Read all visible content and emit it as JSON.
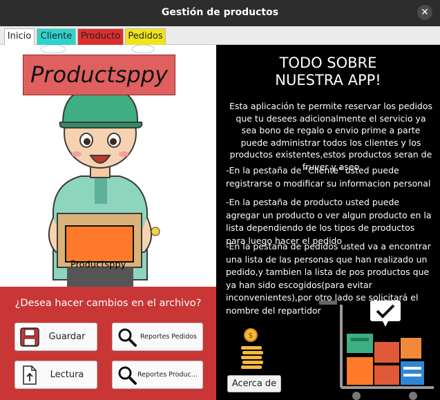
{
  "window": {
    "title": "Gestión de productos",
    "close_symbol": "✕"
  },
  "tabs": [
    {
      "label": "Inicio"
    },
    {
      "label": "Cliente"
    },
    {
      "label": "Producto"
    },
    {
      "label": "Pedidos"
    }
  ],
  "left": {
    "logo_text": "Productsppy",
    "box_text": "Productsppy",
    "question": "¿Desea hacer cambios en el archivo?",
    "buttons": {
      "guardar": "Guardar",
      "reportes_pedidos": "Reportes Pedidos",
      "lectura": "Lectura",
      "reportes_productos": "Reportes Productos"
    }
  },
  "right": {
    "heading_line1": "TODO SOBRE",
    "heading_line2": "NUESTRA APP!",
    "intro": "Esta aplicación  te permite reservar los pedidos que tu desees adicionalmente el servicio ya sea bono de regalo o envio prime a parte puede administrar todos los clientes y los productos existentes,estos productos seran de fruver y aseo",
    "para_cliente": "-En la pestaña de \"Cliente\" usted puede registrarse o modificar su informacion personal",
    "para_producto": "-En la pestaña de producto usted puede agregar un producto o ver algun producto en la lista dependiendo de los tipos de productos para luego hacer el pedido",
    "para_pedidos": "-En la pestaña de pedidos usted va a encontrar una lista de las personas que han realizado un pedido,y tambien la lista de pos productos que ya han sido escogidos(para evitar inconvenientes),por otro lado se solicitará el nombre del repartidor",
    "about_button": "Acerca de"
  },
  "colors": {
    "tab_cliente": "#2fd3c8",
    "tab_producto": "#dd2f2f",
    "tab_pedidos": "#f0e51a",
    "red_area": "#c93636",
    "logo_bg": "#e06060"
  }
}
